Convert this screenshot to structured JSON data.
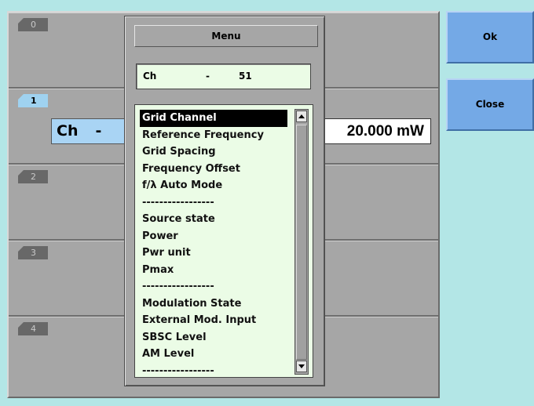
{
  "slots": [
    {
      "tab": "0",
      "active": false
    },
    {
      "tab": "1",
      "active": true,
      "channel_prefix": "Ch",
      "channel_dash": "-",
      "power": "20.000 mW"
    },
    {
      "tab": "2",
      "active": false
    },
    {
      "tab": "3",
      "active": false
    },
    {
      "tab": "4",
      "active": false
    }
  ],
  "buttons": {
    "ok": "Ok",
    "close": "Close"
  },
  "menu": {
    "title": "Menu",
    "channel": {
      "prefix": "Ch",
      "dash": "-",
      "value": "51"
    },
    "items": [
      "Grid Channel",
      "Reference Frequency",
      "Grid Spacing",
      "Frequency Offset",
      "f/λ Auto Mode",
      "-----------------",
      "Source state",
      "Power",
      "Pwr unit",
      "Pmax",
      "-----------------",
      "Modulation State",
      "External Mod. Input",
      "SBSC Level",
      "AM Level",
      "-----------------"
    ],
    "selected_index": 0
  },
  "colors": {
    "background": "#b3e6e6",
    "panel": "#a6a6a6",
    "button": "#74a9e6",
    "active_tab": "#9fd2f0",
    "list_bg": "#ebfce6"
  }
}
